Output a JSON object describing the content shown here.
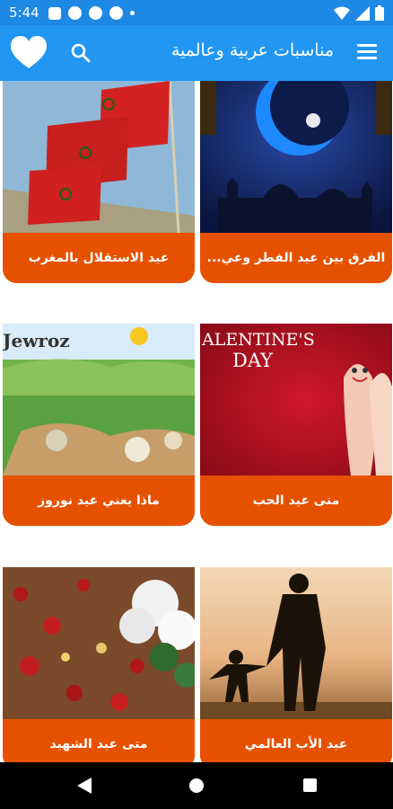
{
  "status_bar": {
    "time": "5:44"
  },
  "app_bar": {
    "title": "مناسبات عربية وعالمية",
    "icons": [
      "menu-icon",
      "search-icon",
      "heart-icon"
    ]
  },
  "cards": [
    {
      "title": "الفرق بين عيد الفطر وعي...",
      "image": "ramadan-mosque-night"
    },
    {
      "title": "عيد الاستقلال بالمغرب",
      "image": "morocco-flags"
    },
    {
      "title": "متى عيد الحب",
      "image": "valentines-day",
      "image_text_line1": "ALENTINE'S",
      "image_text_line2": "DAY"
    },
    {
      "title": "ماذا يعني عيد نوروز",
      "image": "nowruz-painting",
      "image_text": "Jewroz"
    },
    {
      "title": "عيد الأب العالمي",
      "image": "father-child-sunset"
    },
    {
      "title": "متى عيد الشهيد",
      "image": "flowers-rose-petals"
    }
  ],
  "colors": {
    "app_bar": "#2196f3",
    "status_bar": "#1e88e5",
    "card_label": "#e65100"
  }
}
